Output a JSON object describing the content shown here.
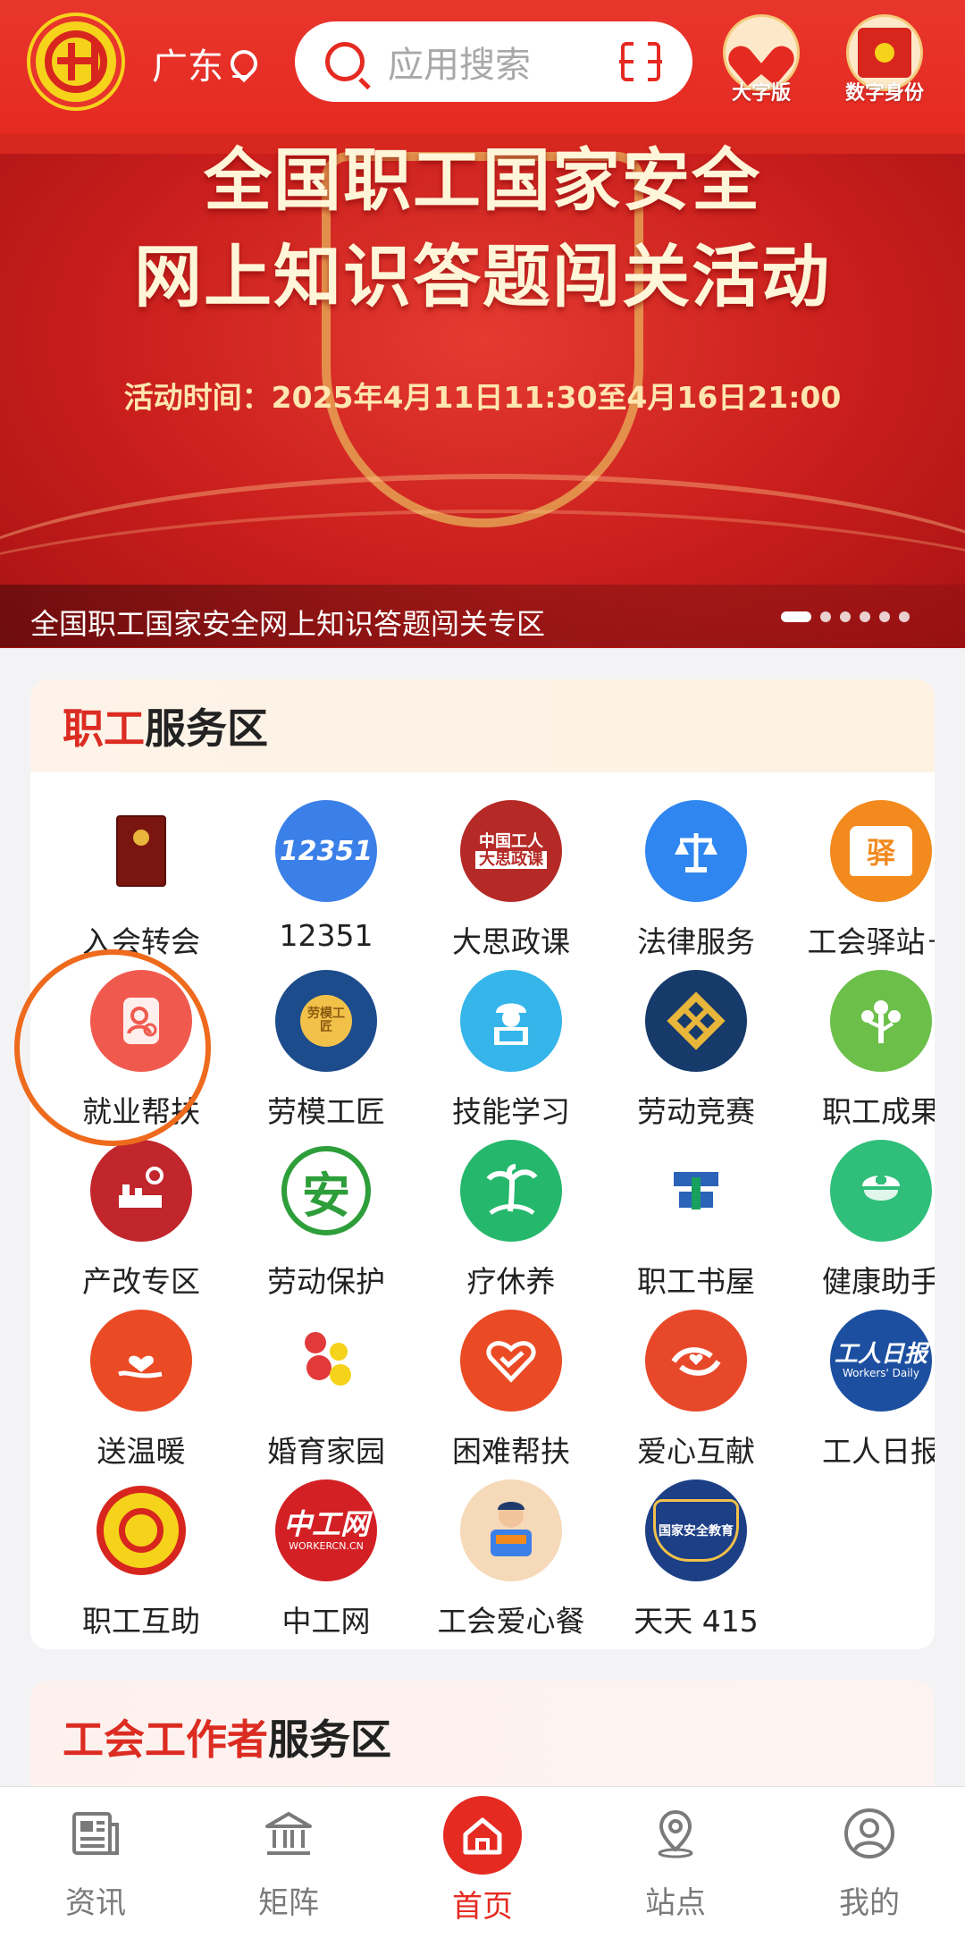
{
  "header": {
    "location": "广东",
    "search_placeholder": "应用搜索",
    "large_font_label": "大字版",
    "digital_id_label": "数字身份"
  },
  "banner": {
    "title_line1": "全国职工国家安全",
    "title_line2": "网上知识答题闯关活动",
    "time": "活动时间：2025年4月11日11:30至4月16日21:00",
    "caption": "全国职工国家安全网上知识答题闯关专区",
    "dots": 6,
    "active_dot": 0
  },
  "service_card": {
    "title_red": "职工",
    "title_rest": "服务区",
    "items": [
      {
        "label": "入会转会",
        "icon": "membership-book-icon",
        "color": "#8b1a14"
      },
      {
        "label": "12351",
        "icon": "hotline-12351-icon",
        "color": "#3b7fe8"
      },
      {
        "label": "大思政课",
        "icon": "ideology-class-icon",
        "color": "#b52a26"
      },
      {
        "label": "法律服务",
        "icon": "scale-icon",
        "color": "#2f86f0"
      },
      {
        "label": "工会驿站＋",
        "icon": "station-house-icon",
        "color": "#f28a1e"
      },
      {
        "label": "就业帮扶",
        "icon": "job-search-icon",
        "color": "#f05a4e"
      },
      {
        "label": "劳模工匠",
        "icon": "medal-icon",
        "color": "#1d4c8c"
      },
      {
        "label": "技能学习",
        "icon": "worker-laptop-icon",
        "color": "#35b5ea"
      },
      {
        "label": "劳动竞赛",
        "icon": "competition-icon",
        "color": "#163a6a"
      },
      {
        "label": "职工成果",
        "icon": "tree-icon",
        "color": "#6cc04a"
      },
      {
        "label": "产改专区",
        "icon": "industry-reform-icon",
        "color": "#c0262c"
      },
      {
        "label": "劳动保护",
        "icon": "safety-badge-icon",
        "color": "#2d9e3a"
      },
      {
        "label": "疗休养",
        "icon": "palm-tree-icon",
        "color": "#25b76c"
      },
      {
        "label": "职工书屋",
        "icon": "book-house-icon",
        "color": "#2a63b8"
      },
      {
        "label": "健康助手",
        "icon": "nurse-icon",
        "color": "#2fbf7a"
      },
      {
        "label": "送温暖",
        "icon": "heart-hand-icon",
        "color": "#ea4a24"
      },
      {
        "label": "婚育家园",
        "icon": "family-icon",
        "color": "#e23a3a"
      },
      {
        "label": "困难帮扶",
        "icon": "help-heart-icon",
        "color": "#ea4a24"
      },
      {
        "label": "爱心互献",
        "icon": "love-exchange-icon",
        "color": "#e8482a"
      },
      {
        "label": "工人日报",
        "icon": "workers-daily-icon",
        "color": "#1c4fa0"
      },
      {
        "label": "职工互助",
        "icon": "mutual-aid-icon",
        "color": "#d7261e"
      },
      {
        "label": "中工网",
        "icon": "workercn-icon",
        "color": "#d32025"
      },
      {
        "label": "工会爱心餐",
        "icon": "love-meal-icon",
        "color": "#f6d9b8"
      },
      {
        "label": "天天 415",
        "icon": "national-security-icon",
        "color": "#1c3f86"
      }
    ],
    "workers_daily_text": "工人日报",
    "workers_daily_en": "Workers' Daily",
    "workercn_text": "中工网",
    "workercn_en": "WORKERCN.CN",
    "hotline_text": "12351",
    "ideology_text1": "中国工人",
    "ideology_text2": "大思政课",
    "station_char": "驿",
    "medal_text": "劳模工匠",
    "security_text": "国家安全教育",
    "safety_char": "安"
  },
  "worker_card": {
    "title_red": "工会工作者",
    "title_rest": "服务区"
  },
  "nav": {
    "items": [
      {
        "label": "资讯",
        "icon": "news-icon"
      },
      {
        "label": "矩阵",
        "icon": "institution-icon"
      },
      {
        "label": "首页",
        "icon": "home-icon"
      },
      {
        "label": "站点",
        "icon": "location-icon"
      },
      {
        "label": "我的",
        "icon": "user-icon"
      }
    ],
    "active": "首页"
  }
}
